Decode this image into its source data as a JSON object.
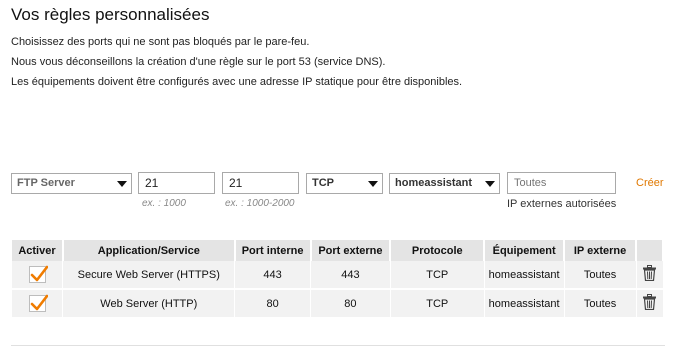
{
  "page": {
    "title": "Vos règles personnalisées",
    "descriptions": [
      "Choisissez des ports qui ne sont pas bloqués par le pare-feu.",
      "Nous vous déconseillons la création d'une règle sur le port 53 (service DNS).",
      "Les équipements doivent être configurés avec une adresse IP statique pour être disponibles."
    ]
  },
  "form": {
    "application": "FTP Server",
    "port_interne": "21",
    "port_interne_hint": "ex. : 1000",
    "port_externe": "21",
    "port_externe_hint": "ex. : 1000-2000",
    "protocole": "TCP",
    "equipement": "homeassistant",
    "ip_placeholder": "Toutes",
    "ip_hint": "IP externes autorisées",
    "create_label": "Créer"
  },
  "table": {
    "headers": [
      "Activer",
      "Application/Service",
      "Port interne",
      "Port externe",
      "Protocole",
      "Équipement",
      "IP externe",
      ""
    ],
    "rows": [
      {
        "active": true,
        "application": "Secure Web Server (HTTPS)",
        "port_interne": "443",
        "port_externe": "443",
        "protocole": "TCP",
        "equipement": "homeassistant",
        "ip_externe": "Toutes"
      },
      {
        "active": true,
        "application": "Web Server (HTTP)",
        "port_interne": "80",
        "port_externe": "80",
        "protocole": "TCP",
        "equipement": "homeassistant",
        "ip_externe": "Toutes"
      }
    ]
  },
  "colors": {
    "accent": "#e07800",
    "header_bg": "#e4e4e4",
    "row_bg": "#f2f2f2"
  },
  "icons": {
    "checkbox": "checkmark-icon",
    "delete": "trash-icon",
    "dropdown": "chevron-down-icon"
  }
}
